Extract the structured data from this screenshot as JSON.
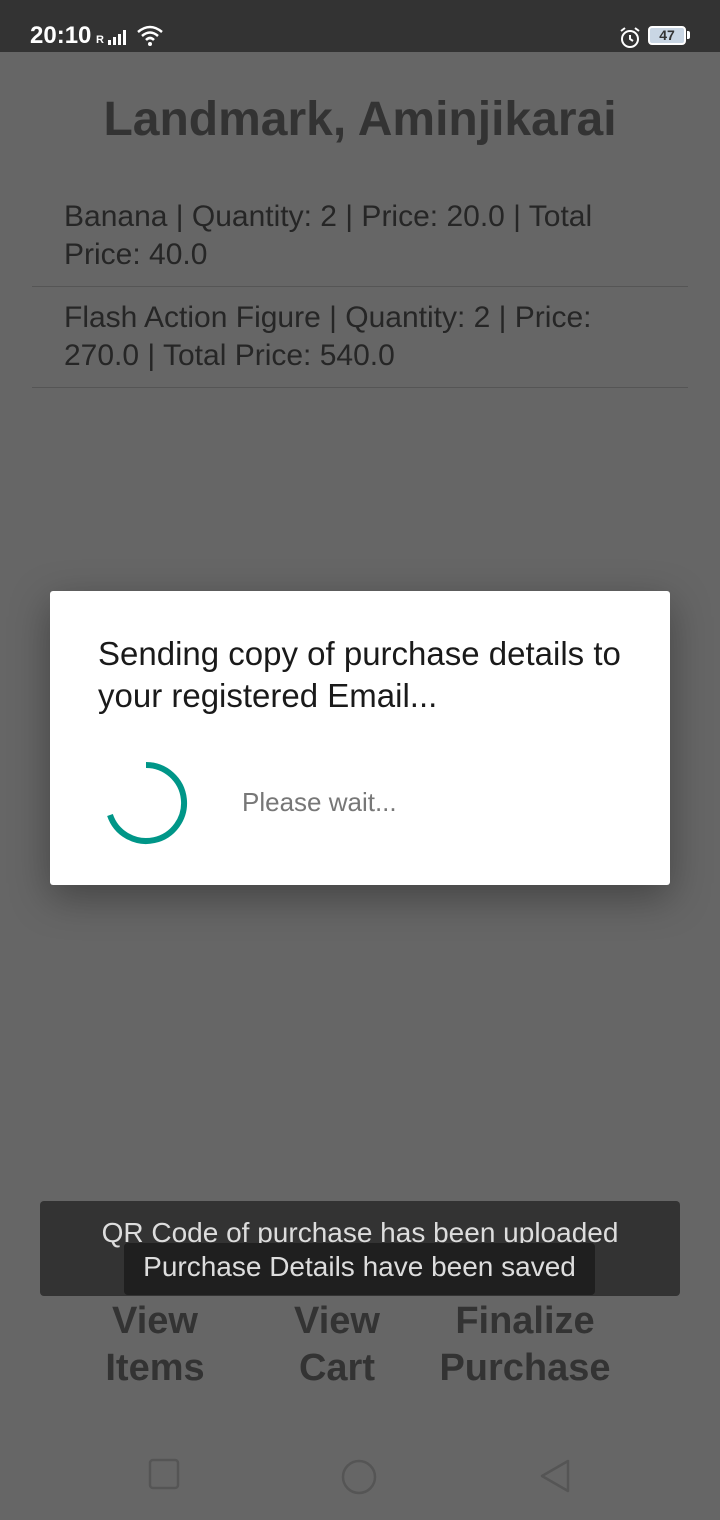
{
  "status_bar": {
    "time": "20:10",
    "signal_label": "R",
    "battery_level": "47",
    "icons": [
      "signal-icon",
      "wifi-icon",
      "alarm-icon",
      "battery-icon"
    ]
  },
  "store": {
    "title": "Landmark, Aminjikarai"
  },
  "cart_items": [
    {
      "text": "Banana | Quantity: 2 | Price: 20.0 | Total Price: 40.0"
    },
    {
      "text": "Flash Action Figure | Quantity: 2 | Price: 270.0 | Total Price: 540.0"
    }
  ],
  "dialog": {
    "title": "Sending copy of purchase details to your registered Email...",
    "message": "Please wait...",
    "accent_color": "#009688"
  },
  "nav_buttons": {
    "view_items": "View Items",
    "view_cart": "View Cart",
    "finalize_purchase": "Finalize Purchase"
  },
  "toasts": {
    "first": "QR Code of purchase has been uploaded successfully",
    "second": "Purchase Details have been saved"
  },
  "system_nav": {
    "icons": [
      "recents-square-icon",
      "home-circle-icon",
      "back-triangle-icon"
    ]
  }
}
